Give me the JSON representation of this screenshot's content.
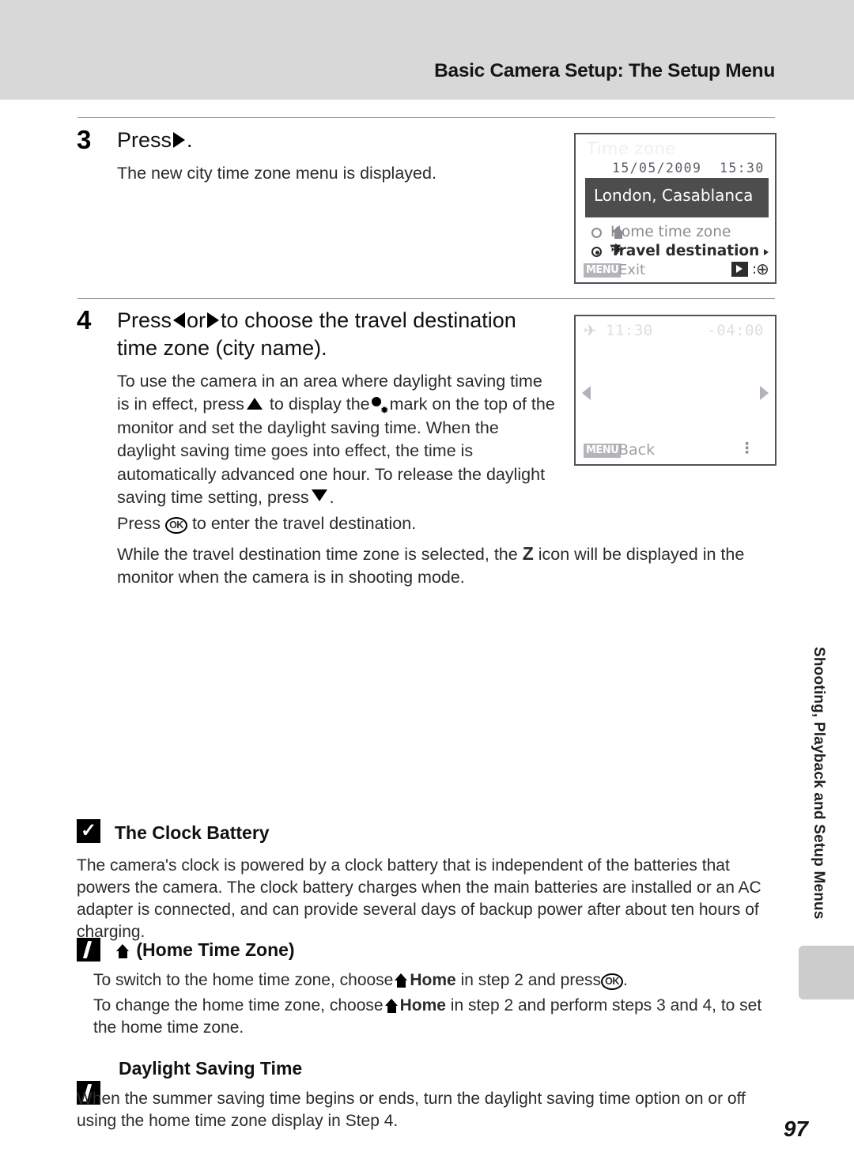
{
  "header": {
    "title": "Basic Camera Setup: The Setup Menu"
  },
  "steps": [
    {
      "number": "3",
      "title_prefix": "Press",
      "title_suffix": ".",
      "description": "The new city time zone menu is displayed."
    },
    {
      "number": "4",
      "title_part1": "Press",
      "title_part2": "or",
      "title_part3": "to choose the travel destination time zone (city name).",
      "paragraph1_a": "To use the camera in an area where daylight saving time is in effect, press",
      "paragraph1_b": "to display the",
      "paragraph1_c": "mark on the top of the monitor and set the daylight saving time. When the daylight saving time goes into effect, the time is automatically advanced one hour. To release the daylight saving time setting, press",
      "paragraph1_d": ".",
      "paragraph2_a": "Press",
      "paragraph2_b": "to enter the travel destination.",
      "paragraph3_a": "While the travel destination time zone is selected, the",
      "paragraph3_icon": "Z",
      "paragraph3_b": "icon will be displayed in the monitor when the camera is in shooting mode."
    }
  ],
  "lcd1": {
    "title": "Time zone",
    "datetime": "15/05/2009  15:30",
    "city": "London, Casablanca",
    "option_home": "Home time zone",
    "option_travel": "Travel destination",
    "menu_chip": "MENU",
    "exit_label": "Exit",
    "colon": ":",
    "globe_icon": "⊕",
    "selected_option": "Travel destination",
    "highlight_color": "#4d4d4d"
  },
  "lcd2": {
    "time": "11:30",
    "offset": "-04:00",
    "menu_chip": "MENU",
    "back_label": "Back",
    "dots": "⋮"
  },
  "notes": [
    {
      "icon": "check",
      "heading": "The Clock Battery",
      "body": "The camera's clock is powered by a clock battery that is independent of the batteries that powers the camera. The clock battery charges when the main batteries are installed or an AC adapter is connected, and can provide several days of backup power after about ten hours of charging."
    },
    {
      "icon": "pencil",
      "heading": "(Home Time Zone)",
      "line1_a": "To switch to the home time zone, choose",
      "line1_home": "Home",
      "line1_b": "in step 2 and press",
      "line1_c": ".",
      "line2_a": "To change the home time zone, choose",
      "line2_home": "Home",
      "line2_b": "in step 2 and perform steps 3 and 4, to set the home time zone."
    },
    {
      "icon": "pencil",
      "heading": "Daylight Saving Time",
      "body": "When the summer saving time begins or ends, turn the daylight saving time option on or off using the home time zone display in Step 4."
    }
  ],
  "side_tab_text": "Shooting, Playback and Setup Menus",
  "page_number": "97",
  "ok_label": "OK"
}
